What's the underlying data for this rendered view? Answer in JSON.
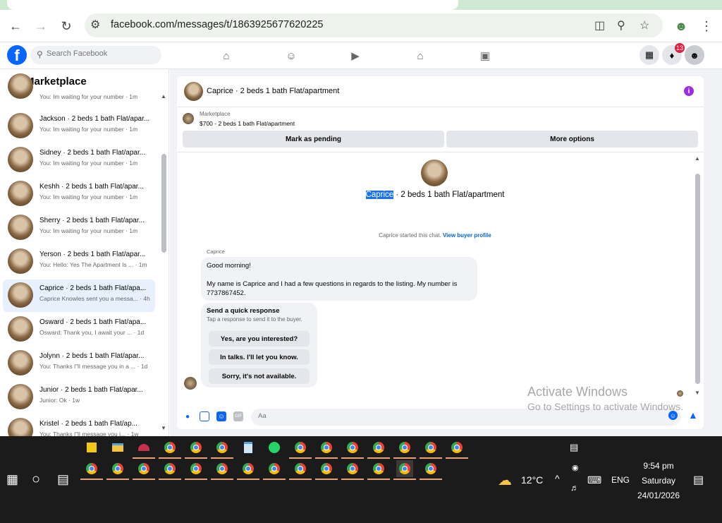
{
  "browser": {
    "url": "facebook.com/messages/t/1863925677620225"
  },
  "fb": {
    "search_placeholder": "Search Facebook",
    "notif_count": "13"
  },
  "sidebar": {
    "title": "Marketplace",
    "top_preview": "You: Im waiting for your number · 1m",
    "items": [
      {
        "name": "Jackson · 2 beds 1 bath Flat/apar...",
        "preview": "You: Im waiting for your number · 1m"
      },
      {
        "name": "Sidney · 2 beds 1 bath Flat/apar...",
        "preview": "You: Im waiting for your number · 1m"
      },
      {
        "name": "Keshh · 2 beds 1 bath Flat/apar...",
        "preview": "You: Im waiting for your number · 1m"
      },
      {
        "name": "Sherry · 2 beds 1 bath Flat/apar...",
        "preview": "You: Im waiting for your number · 1m"
      },
      {
        "name": "Yerson · 2 beds 1 bath Flat/apar...",
        "preview": "You: Hello: Yes The Apartment Is ... · 1m"
      },
      {
        "name": "Caprice · 2 beds 1 bath Flat/apa...",
        "preview": "Caprice Knowles sent you a messa... · 4h"
      },
      {
        "name": "Osward · 2 beds 1 bath Flat/apa...",
        "preview": "Osward: Thank you, I await your ... · 1d"
      },
      {
        "name": "Jolynn · 2 beds 1 bath Flat/apar...",
        "preview": "You: Thanks i\"ll message you in a ... · 1d"
      },
      {
        "name": "Junior · 2 beds 1 bath Flat/apar...",
        "preview": "Junior: Ok · 1w"
      },
      {
        "name": "Kristel · 2 beds 1 bath Flat/ap...",
        "preview": "You: Thanks i\"ll message you i... · 1w"
      }
    ]
  },
  "chat": {
    "header_title": "Caprice · 2 beds 1 bath Flat/apartment",
    "marketplace_label": "Marketplace",
    "listing": "$700 - 2 beds 1 bath Flat/apartment",
    "mark_pending": "Mark as pending",
    "more_options": "More options",
    "intro_name": "Caprice",
    "intro_rest": " · 2 beds 1 bath Flat/apartment",
    "started_text": "Caprice started this chat.",
    "view_profile": "View buyer profile",
    "sender": "Caprice",
    "message_line1": "Good morning!",
    "message_line2": "My name is Caprice and I had a few questions in regards to the listing. My number is 7737867452.",
    "quick_title": "Send a quick response",
    "quick_sub": "Tap a response to send it to the buyer.",
    "quick_responses": [
      "Yes, are you interested?",
      "In talks. I'll let you know.",
      "Sorry, it's not available."
    ],
    "composer_placeholder": "Aa"
  },
  "watermark": {
    "line1": "Activate Windows",
    "line2": "Go to Settings to activate Windows."
  },
  "taskbar": {
    "weather": "12°C",
    "lang": "ENG",
    "time": "9:54 pm",
    "day": "Saturday",
    "date": "24/01/2026"
  }
}
